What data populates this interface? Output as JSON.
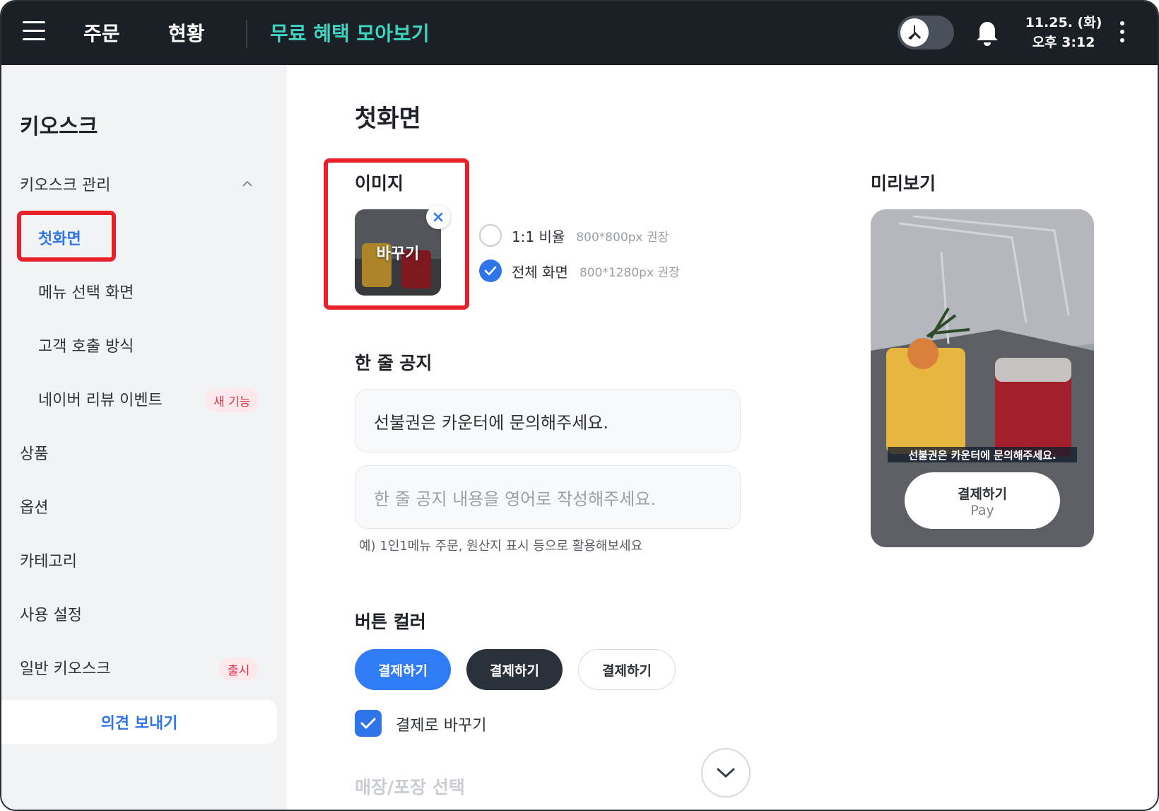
{
  "topbar": {
    "nav": [
      "주문",
      "현황"
    ],
    "highlight": "무료 혜택 모아보기",
    "date": "11.25. (화)",
    "time": "오후 3:12"
  },
  "sidebar": {
    "title": "키오스크",
    "group": "키오스크 관리",
    "sub_items": [
      {
        "label": "첫화면",
        "active": true
      },
      {
        "label": "메뉴 선택 화면"
      },
      {
        "label": "고객 호출 방식"
      },
      {
        "label": "네이버 리뷰 이벤트",
        "badge": "새 기능"
      }
    ],
    "main_items": [
      {
        "label": "상품"
      },
      {
        "label": "옵션"
      },
      {
        "label": "카테고리"
      },
      {
        "label": "사용 설정"
      },
      {
        "label": "일반 키오스크",
        "badge": "출시"
      }
    ],
    "feedback": "의견 보내기"
  },
  "main": {
    "title": "첫화면",
    "image_section": {
      "label": "이미지",
      "thumb_label": "바꾸기",
      "options": [
        {
          "label": "1:1 비율",
          "hint": "800*800px 권장",
          "checked": false
        },
        {
          "label": "전체 화면",
          "hint": "800*1280px 권장",
          "checked": true
        }
      ]
    },
    "notice_section": {
      "label": "한 줄 공지",
      "value": "선불권은 카운터에 문의해주세요.",
      "placeholder_en": "한 줄 공지 내용을 영어로 작성해주세요.",
      "hint": "예) 1인1메뉴 주문, 원산지 표시 등으로 활용해보세요"
    },
    "button_color_section": {
      "label": "버튼 컬러",
      "options": [
        {
          "label": "결제하기",
          "bg": "#2f7cf6",
          "fg": "#ffffff"
        },
        {
          "label": "결제하기",
          "bg": "#2b313b",
          "fg": "#ffffff"
        },
        {
          "label": "결제하기",
          "bg": "#ffffff",
          "fg": "#2d3238"
        }
      ],
      "checkbox_label": "결제로 바꾸기",
      "checkbox_checked": true
    },
    "next_section_label": "매장/포장 선택"
  },
  "preview": {
    "label": "미리보기",
    "notice": "선불권은 카운터에 문의해주세요.",
    "pay_main": "결제하기",
    "pay_sub": "Pay"
  },
  "colors": {
    "accent": "#2f74e9",
    "teal": "#3fd3c0",
    "highlight_box": "#e8202a",
    "badge_text": "#e0314b"
  }
}
